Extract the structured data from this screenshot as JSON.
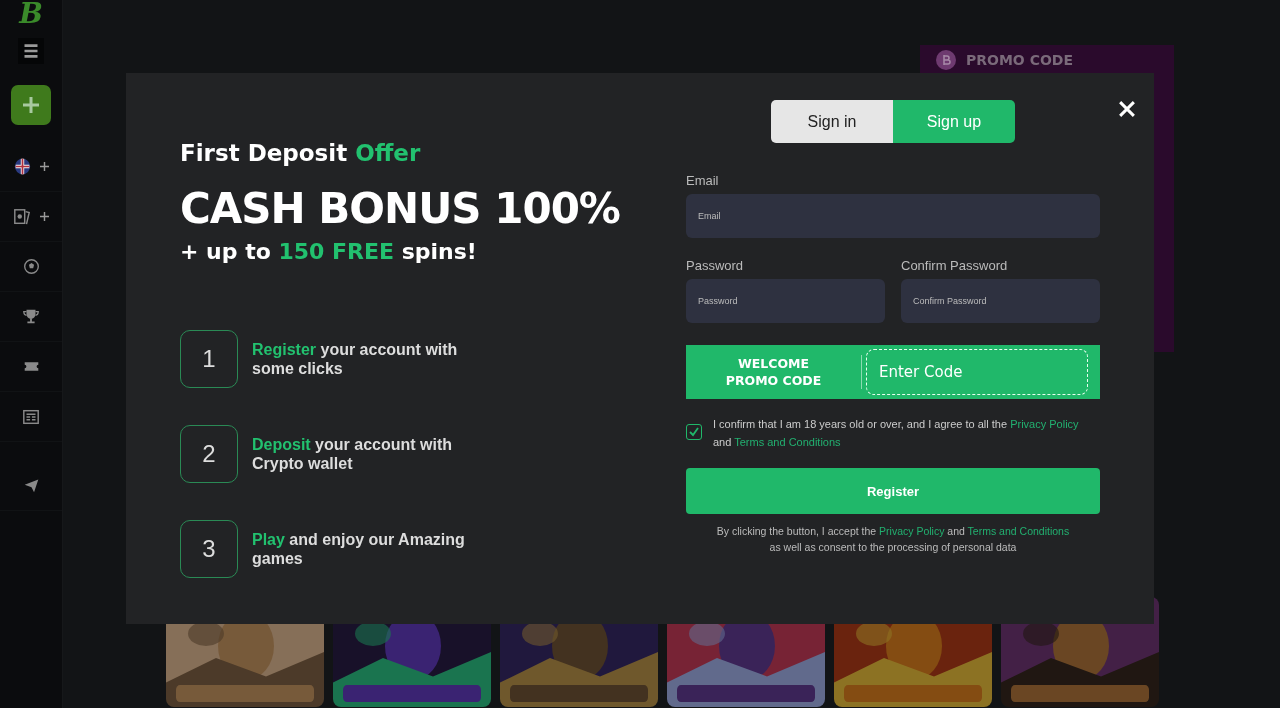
{
  "sidebar": {
    "logo": "B",
    "items": [
      {
        "kind": "flag",
        "expandable": true
      },
      {
        "kind": "cards",
        "expandable": true
      },
      {
        "kind": "ball",
        "expandable": false
      },
      {
        "kind": "trophy",
        "expandable": false
      },
      {
        "kind": "ticket",
        "expandable": false
      },
      {
        "kind": "news",
        "expandable": false
      },
      {
        "kind": "send",
        "expandable": false
      }
    ]
  },
  "promo_banner": {
    "title": "PROMO CODE"
  },
  "modal": {
    "offer": {
      "title": "First Deposit",
      "title_highlight": "Offer",
      "headline": "CASH BONUS 100%",
      "sub_before": "+ up to",
      "sub_highlight": "150 FREE",
      "sub_after": "spins!"
    },
    "steps": [
      {
        "number": "1",
        "highlight": "Register",
        "text": "your account with some clicks"
      },
      {
        "number": "2",
        "highlight": "Deposit",
        "text": "your account with Crypto wallet"
      },
      {
        "number": "3",
        "highlight": "Play",
        "text": "and enjoy our Amazing games"
      }
    ],
    "tabs": [
      {
        "label": "Sign in",
        "selected": false
      },
      {
        "label": "Sign up",
        "selected": true
      }
    ],
    "email": {
      "label": "Email",
      "placeholder": "Email"
    },
    "password": {
      "label": "Password",
      "placeholder": "Password"
    },
    "confirm_password": {
      "label": "Confirm Password",
      "placeholder": "Confirm Password"
    },
    "promo": {
      "label": "WELCOME PROMO CODE",
      "placeholder": "Enter Code"
    },
    "consent": {
      "checked": true,
      "text": "I confirm that I am 18 years old or over, and I agree to all the",
      "link1": "Privacy Policy",
      "joiner": "and",
      "link2": "Terms and Conditions"
    },
    "register": "Register",
    "note": {
      "before": "By clicking the button, I accept the",
      "link1": "Privacy Policy",
      "joiner": "and",
      "link2": "Terms and Conditions",
      "after": "as well as consent to the processing of personal data"
    }
  }
}
